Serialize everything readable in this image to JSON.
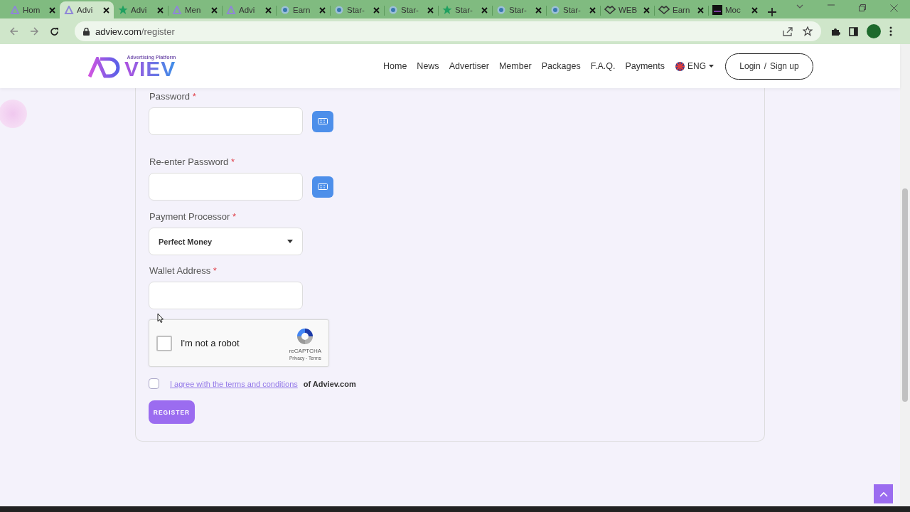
{
  "browser": {
    "tabs": [
      {
        "title": "Hom",
        "kind": "logo",
        "selected": false
      },
      {
        "title": "Advi",
        "kind": "logo",
        "selected": true
      },
      {
        "title": "Advi",
        "kind": "star",
        "selected": false
      },
      {
        "title": "Men",
        "kind": "logo",
        "selected": false
      },
      {
        "title": "Advi",
        "kind": "logo",
        "selected": false
      },
      {
        "title": "Earn",
        "kind": "ring",
        "selected": false
      },
      {
        "title": "Star-",
        "kind": "ring",
        "selected": false
      },
      {
        "title": "Star-",
        "kind": "ring",
        "selected": false
      },
      {
        "title": "Star-",
        "kind": "star",
        "selected": false
      },
      {
        "title": "Star-",
        "kind": "ring",
        "selected": false
      },
      {
        "title": "Star-",
        "kind": "ring",
        "selected": false
      },
      {
        "title": "WEB",
        "kind": "hand",
        "selected": false
      },
      {
        "title": "Earn",
        "kind": "hand",
        "selected": false
      },
      {
        "title": "Moc",
        "kind": "square",
        "selected": false
      }
    ],
    "url_host": "adviev.com",
    "url_path": "/register"
  },
  "header": {
    "logo": {
      "wordmark": "VIEV",
      "tagline": "Advertising Platform"
    },
    "nav": [
      "Home",
      "News",
      "Advertiser",
      "Member",
      "Packages",
      "F.A.Q.",
      "Payments"
    ],
    "language": "ENG",
    "login": "Login",
    "separator": "/",
    "signup": "Sign up"
  },
  "form": {
    "fields": [
      {
        "kind": "password",
        "label": "Password",
        "mark": "*"
      },
      {
        "kind": "password",
        "label": "Re-enter Password",
        "mark": "*"
      },
      {
        "kind": "select",
        "label": "Payment Processor",
        "mark": "*",
        "value": "Perfect Money"
      },
      {
        "kind": "text",
        "label": "Wallet Address",
        "mark": "*"
      }
    ],
    "captcha": {
      "label": "I'm not a robot",
      "checked": false,
      "brand": "reCAPTCHA",
      "privacy": "Privacy",
      "dash": "-",
      "terms": "Terms"
    },
    "agree": {
      "checked": false,
      "link": "I agree with the terms and conditions",
      "rest": "of Adviev.com"
    },
    "submit": "REGISTER"
  }
}
